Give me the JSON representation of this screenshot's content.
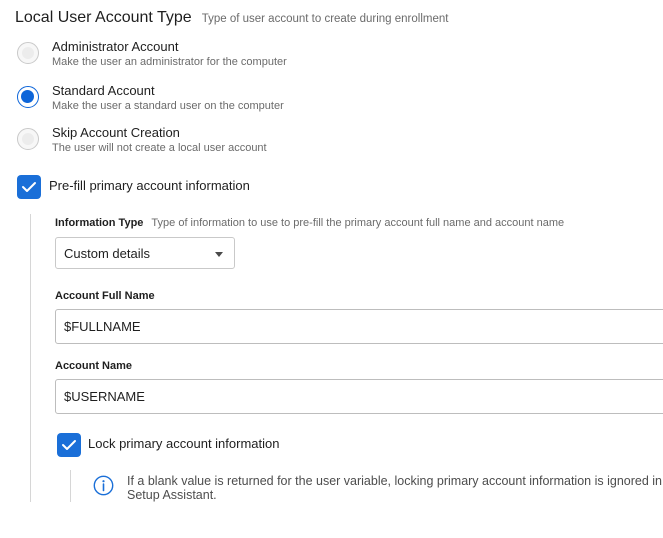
{
  "section": {
    "title": "Local User Account Type",
    "description": "Type of user account to create during enrollment"
  },
  "account_types": [
    {
      "label": "Administrator Account",
      "description": "Make the user an administrator for the computer",
      "selected": false
    },
    {
      "label": "Standard Account",
      "description": "Make the user a standard user on the computer",
      "selected": true
    },
    {
      "label": "Skip Account Creation",
      "description": "The user will not create a local user account",
      "selected": false
    }
  ],
  "prefill": {
    "label": "Pre-fill primary account information",
    "checked": true
  },
  "information_type": {
    "label": "Information Type",
    "description": "Type of information to use to pre-fill the primary account full name and account name",
    "selected": "Custom details"
  },
  "full_name": {
    "label": "Account Full Name",
    "value": "$FULLNAME"
  },
  "account_name": {
    "label": "Account Name",
    "value": "$USERNAME"
  },
  "lock": {
    "label": "Lock primary account information",
    "checked": true
  },
  "info_note": "If a blank value is returned for the user variable, locking primary account information is ignored in Setup Assistant.",
  "colors": {
    "accent": "#1a6fd8",
    "radio_selected": "#0d65d9"
  }
}
